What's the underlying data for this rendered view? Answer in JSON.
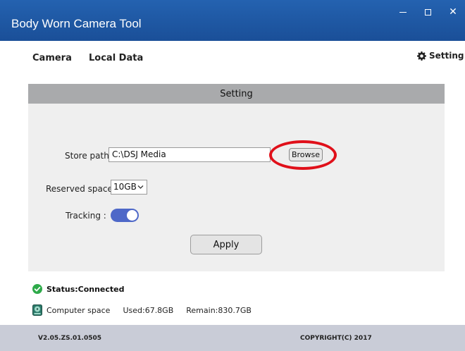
{
  "window": {
    "title": "Body Worn Camera Tool",
    "controls": {
      "minimize": "minimize-icon",
      "maximize": "maximize-icon",
      "close": "close-icon",
      "close_glyph": "✕"
    },
    "accent": "#1f5aa6"
  },
  "nav": {
    "items": [
      {
        "label": "Camera"
      },
      {
        "label": "Local Data"
      }
    ],
    "setting_label": "Setting",
    "setting_icon": "gear-icon"
  },
  "settings": {
    "header": "Setting",
    "store_path_label": "Store path:",
    "store_path_value": "C:\\DSJ Media",
    "browse_label": "Browse",
    "reserved_label": "Reserved space:",
    "reserved_value": "10GB",
    "tracking_label": "Tracking :",
    "tracking_on": true,
    "apply_label": "Apply",
    "highlight_color": "#e0101a",
    "toggle_color": "#4e68c8"
  },
  "status": {
    "text": "Status:Connected",
    "icon": "check-circle-icon",
    "icon_color": "#2eaa4a"
  },
  "storage": {
    "icon": "disk-icon",
    "label": "Computer space",
    "used": "Used:67.8GB",
    "remain": "Remain:830.7GB"
  },
  "footer": {
    "version": "V2.05.ZS.01.0505",
    "copyright": "COPYRIGHT(C) 2017"
  }
}
